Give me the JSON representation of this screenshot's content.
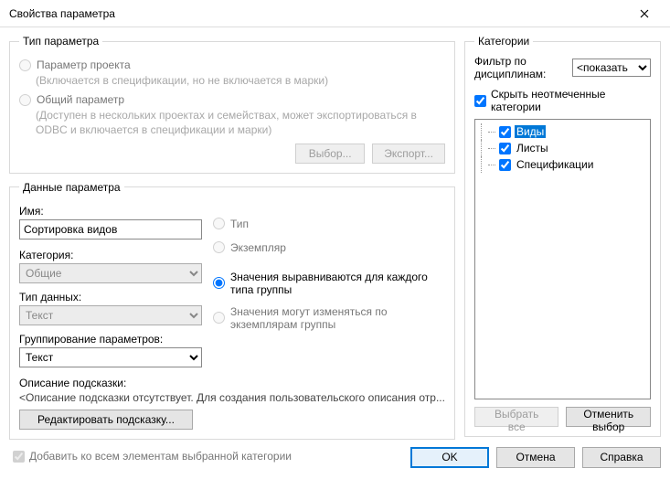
{
  "window": {
    "title": "Свойства параметра"
  },
  "paramType": {
    "legend": "Тип параметра",
    "project": {
      "label": "Параметр проекта",
      "hint": "(Включается в спецификации, но не включается в марки)"
    },
    "shared": {
      "label": "Общий параметр",
      "hint": "(Доступен в нескольких проектах и семействах, может экспортироваться в ODBC и включается в спецификации и марки)"
    },
    "chooseBtn": "Выбор...",
    "exportBtn": "Экспорт..."
  },
  "paramData": {
    "legend": "Данные параметра",
    "nameLabel": "Имя:",
    "nameValue": "Сортировка видов",
    "categoryLabel": "Категория:",
    "categoryValue": "Общие",
    "typeLabel": "Тип данных:",
    "typeValue": "Текст",
    "groupLabel": "Группирование параметров:",
    "groupValue": "Текст",
    "radioType": "Тип",
    "radioInstance": "Экземпляр",
    "alignPerGroup": "Значения выравниваются для каждого типа группы",
    "varyPerInstance": "Значения могут изменяться по экземплярам группы",
    "tooltipLabel": "Описание подсказки:",
    "tooltipDesc": "<Описание подсказки отсутствует. Для создания пользовательского описания отр...",
    "editTooltipBtn": "Редактировать подсказку..."
  },
  "categories": {
    "legend": "Категории",
    "filterLabel": "Фильтр по дисциплинам:",
    "filterValue": "<показать",
    "hideUnchecked": "Скрыть неотмеченные категории",
    "items": [
      {
        "label": "Виды",
        "checked": true,
        "selected": true
      },
      {
        "label": "Листы",
        "checked": true,
        "selected": false
      },
      {
        "label": "Спецификации",
        "checked": true,
        "selected": false
      }
    ],
    "selectAll": "Выбрать все",
    "deselectAll": "Отменить выбор"
  },
  "footer": {
    "addToAll": "Добавить ко всем элементам выбранной категории",
    "ok": "OK",
    "cancel": "Отмена",
    "help": "Справка"
  }
}
